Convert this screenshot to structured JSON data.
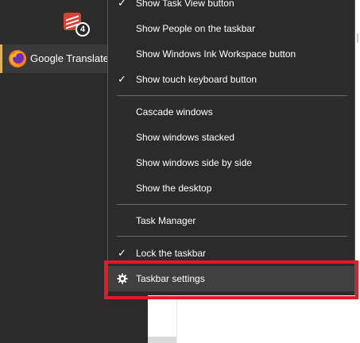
{
  "taskbar": {
    "todoist_badge": "4",
    "firefox_label": "Google Translate -",
    "active_color": "#e0b15a"
  },
  "menu": {
    "items": [
      {
        "label": "Show Task View button",
        "checked": true
      },
      {
        "label": "Show People on the taskbar",
        "checked": false
      },
      {
        "label": "Show Windows Ink Workspace button",
        "checked": false
      },
      {
        "label": "Show touch keyboard button",
        "checked": true
      },
      {
        "label": "Cascade windows",
        "checked": false
      },
      {
        "label": "Show windows stacked",
        "checked": false
      },
      {
        "label": "Show windows side by side",
        "checked": false
      },
      {
        "label": "Show the desktop",
        "checked": false
      },
      {
        "label": "Task Manager",
        "checked": false
      },
      {
        "label": "Lock the taskbar",
        "checked": true
      },
      {
        "label": "Taskbar settings",
        "checked": false,
        "icon": "gear-icon",
        "highlighted": true
      }
    ],
    "check_glyph": "✓",
    "background": "#2b2b2b",
    "highlight_color": "#e01b2a"
  }
}
